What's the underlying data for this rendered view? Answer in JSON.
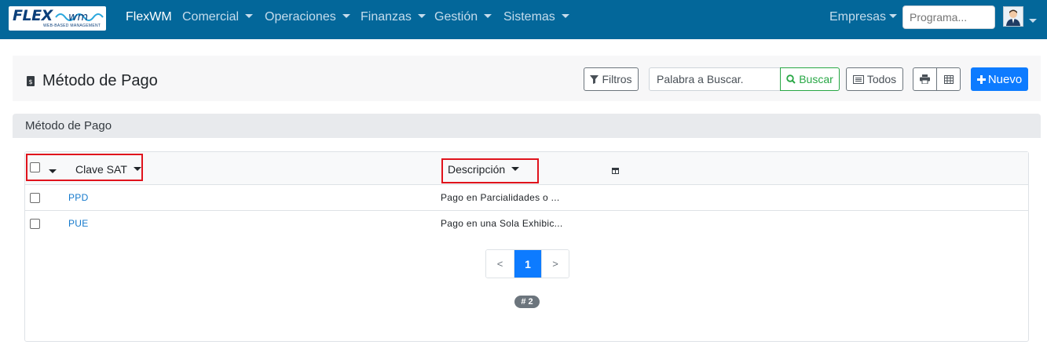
{
  "navbar": {
    "logo_text": "FLEX",
    "logo_suffix": "wm",
    "logo_tagline": "WEB-BASED MANAGEMENT",
    "brand": "FlexWM",
    "menus": [
      {
        "label": "Comercial"
      },
      {
        "label": "Operaciones"
      },
      {
        "label": "Finanzas"
      },
      {
        "label": "Gestión"
      },
      {
        "label": "Sistemas"
      }
    ],
    "empresas_label": "Empresas",
    "program_search_placeholder": "Programa...",
    "color": "#03679a"
  },
  "header": {
    "title": "Método de Pago",
    "filters_label": "Filtros",
    "search_placeholder": "Palabra a Buscar.",
    "search_button": "Buscar",
    "all_label": "Todos",
    "new_label": "Nuevo"
  },
  "section": {
    "title": "Método de Pago"
  },
  "table": {
    "columns": [
      "Clave SAT",
      "Descripción"
    ],
    "rows": [
      {
        "clave": "PPD",
        "descripcion": "Pago en Parcialidades o ..."
      },
      {
        "clave": "PUE",
        "descripcion": "Pago en una Sola Exhibic..."
      }
    ],
    "pagination": {
      "prev": "<",
      "current": "1",
      "next": ">"
    },
    "count_badge": "# 2"
  }
}
